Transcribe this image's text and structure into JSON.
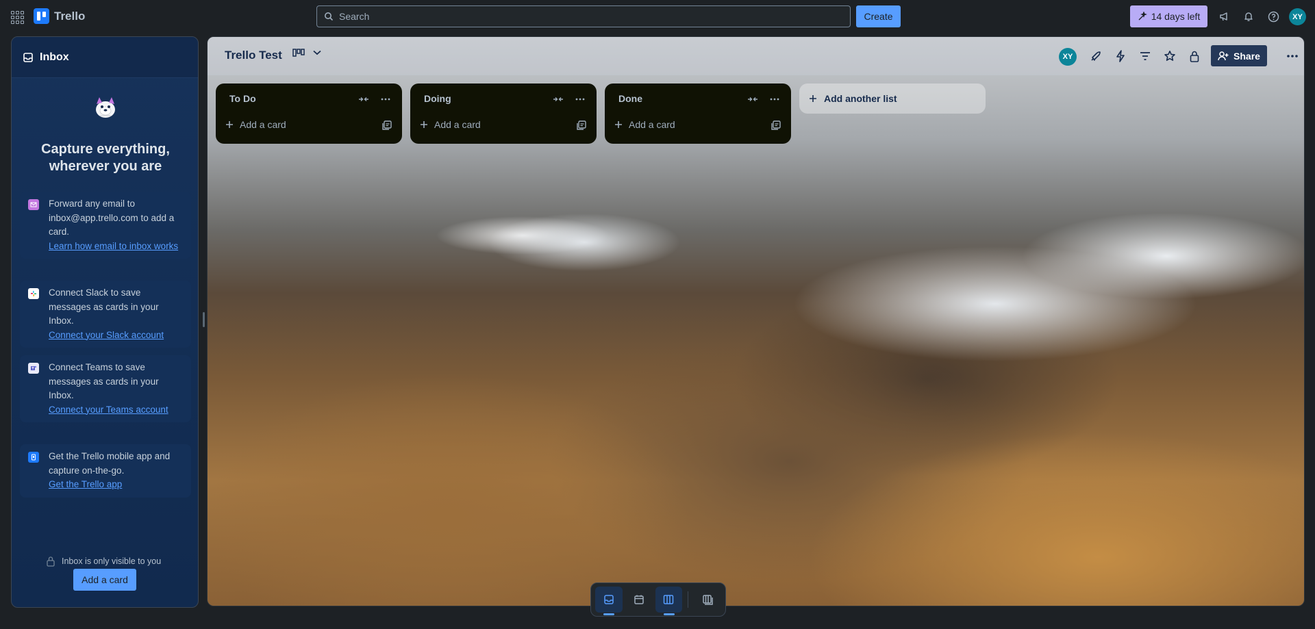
{
  "topbar": {
    "app_name": "Trello",
    "search_placeholder": "Search",
    "create_label": "Create",
    "trial_label": "14 days left",
    "avatar_initials": "XY",
    "icons": [
      "apps-grid-icon",
      "megaphone-icon",
      "bell-icon",
      "help-icon"
    ]
  },
  "inbox": {
    "title": "Inbox",
    "heading_line1": "Capture everything,",
    "heading_line2": "wherever you are",
    "tips": [
      {
        "text": "Forward any email to inbox@app.trello.com to add a card.",
        "link": "Learn how email to inbox works",
        "icon": "email-icon",
        "color": "#c377e0"
      },
      {
        "text": "Connect Slack to save messages as cards in your Inbox.",
        "link": "Connect your Slack account",
        "icon": "slack-icon",
        "color": "#ffffff"
      },
      {
        "text": "Connect Teams to save messages as cards in your Inbox.",
        "link": "Connect your Teams account",
        "icon": "teams-icon",
        "color": "#5b5fc7"
      },
      {
        "text": "Get the Trello mobile app and capture on-the-go.",
        "link": "Get the Trello app",
        "icon": "mobile-icon",
        "color": "#1d7afc"
      }
    ],
    "visibility_note": "Inbox is only visible to you",
    "add_card_label": "Add a card"
  },
  "board": {
    "title": "Trello Test",
    "avatar_initials": "XY",
    "share_label": "Share",
    "lists": [
      {
        "title": "To Do",
        "add_card": "Add a card"
      },
      {
        "title": "Doing",
        "add_card": "Add a card"
      },
      {
        "title": "Done",
        "add_card": "Add a card"
      }
    ],
    "add_list_label": "Add another list"
  },
  "bottom_nav": {
    "items": [
      "inbox-icon",
      "calendar-icon",
      "board-icon",
      "switch-boards-icon"
    ],
    "active": [
      "inbox-icon",
      "board-icon"
    ]
  },
  "colors": {
    "accent": "#579dff",
    "trial": "#b8acf6",
    "list_bg": "#101204",
    "share_bg": "#253858"
  }
}
